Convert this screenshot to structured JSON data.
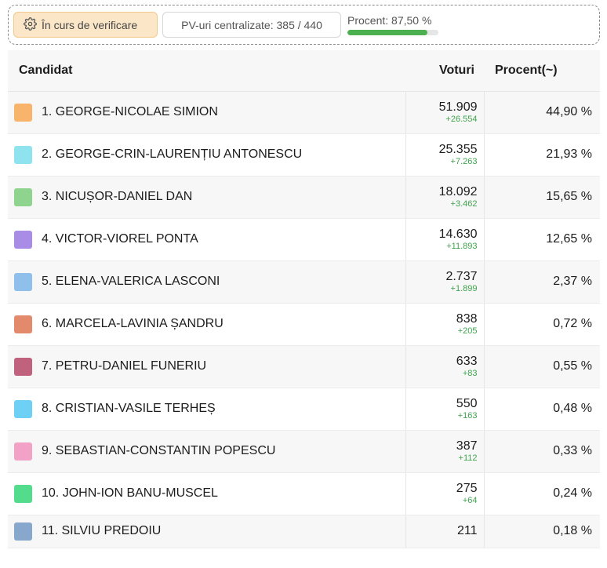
{
  "status": {
    "verification_label": "În curs de verificare",
    "pv_label": "PV-uri centralizate: 385 / 440",
    "percent_label": "Procent: 87,50 %",
    "percent_value": 87.5,
    "progress_color": "#4caf50"
  },
  "table": {
    "headers": {
      "candidate": "Candidat",
      "votes": "Voturi",
      "percent": "Procent(~)"
    },
    "rows": [
      {
        "name": "1. GEORGE-NICOLAE SIMION",
        "votes": "51.909",
        "delta": "+26.554",
        "percent": "44,90 %",
        "color": "#f9b46b"
      },
      {
        "name": "2. GEORGE-CRIN-LAURENȚIU ANTONESCU",
        "votes": "25.355",
        "delta": "+7.263",
        "percent": "21,93 %",
        "color": "#8fe3ef"
      },
      {
        "name": "3. NICUȘOR-DANIEL DAN",
        "votes": "18.092",
        "delta": "+3.462",
        "percent": "15,65 %",
        "color": "#8ed48e"
      },
      {
        "name": "4. VICTOR-VIOREL PONTA",
        "votes": "14.630",
        "delta": "+11.893",
        "percent": "12,65 %",
        "color": "#a98ce6"
      },
      {
        "name": "5. ELENA-VALERICA LASCONI",
        "votes": "2.737",
        "delta": "+1.899",
        "percent": "2,37 %",
        "color": "#8fc0ec"
      },
      {
        "name": "6. MARCELA-LAVINIA ȘANDRU",
        "votes": "838",
        "delta": "+205",
        "percent": "0,72 %",
        "color": "#e48a6c"
      },
      {
        "name": "7. PETRU-DANIEL FUNERIU",
        "votes": "633",
        "delta": "+83",
        "percent": "0,55 %",
        "color": "#c0627e"
      },
      {
        "name": "8. CRISTIAN-VASILE TERHEȘ",
        "votes": "550",
        "delta": "+163",
        "percent": "0,48 %",
        "color": "#6fd0f5"
      },
      {
        "name": "9. SEBASTIAN-CONSTANTIN POPESCU",
        "votes": "387",
        "delta": "+112",
        "percent": "0,33 %",
        "color": "#f2a2c7"
      },
      {
        "name": "10. JOHN-ION BANU-MUSCEL",
        "votes": "275",
        "delta": "+64",
        "percent": "0,24 %",
        "color": "#52dc8c"
      },
      {
        "name": "11. SILVIU PREDOIU",
        "votes": "211",
        "delta": "",
        "percent": "0,18 %",
        "color": "#88a7cc"
      }
    ]
  }
}
